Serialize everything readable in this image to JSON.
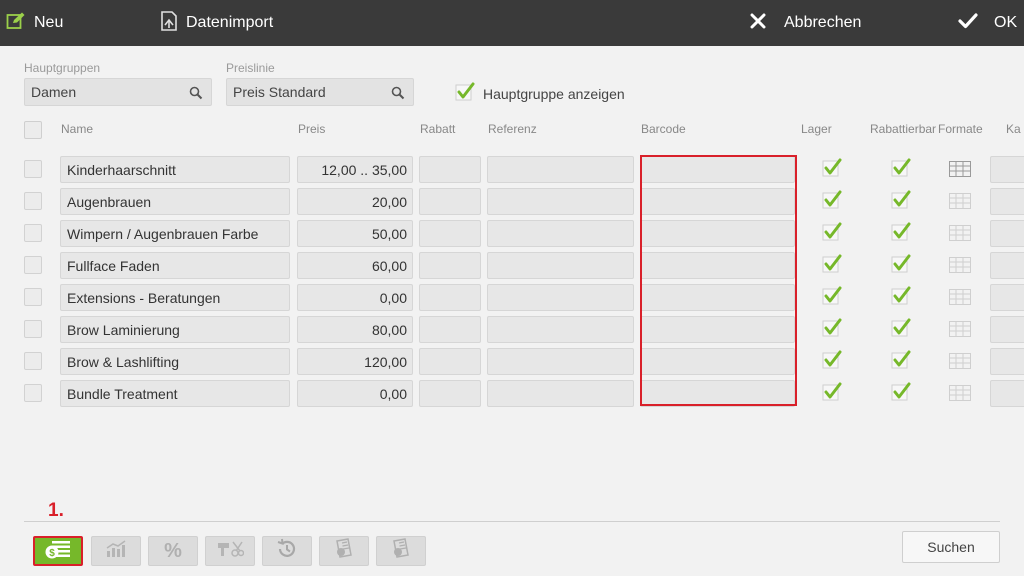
{
  "toolbar": {
    "new_label": "Neu",
    "import_label": "Datenimport",
    "cancel_label": "Abbrechen",
    "ok_label": "OK"
  },
  "filters": {
    "main_group_label": "Hauptgruppen",
    "main_group_value": "Damen",
    "price_line_label": "Preislinie",
    "price_line_value": "Preis Standard",
    "show_main_group_label": "Hauptgruppe anzeigen",
    "show_main_group_checked": true
  },
  "table": {
    "headers": {
      "name": "Name",
      "price": "Preis",
      "discount": "Rabatt",
      "reference": "Referenz",
      "barcode": "Barcode",
      "stock": "Lager",
      "discountable": "Rabattierbar",
      "formats": "Formate",
      "extra": "Ka"
    },
    "rows": [
      {
        "name": "Kinderhaarschnitt",
        "price": "12,00 .. 35,00",
        "stock": true,
        "discountable": true
      },
      {
        "name": "Augenbrauen",
        "price": "20,00",
        "stock": true,
        "discountable": true
      },
      {
        "name": "Wimpern / Augenbrauen Farbe",
        "price": "50,00",
        "stock": true,
        "discountable": true
      },
      {
        "name": "Fullface Faden",
        "price": "60,00",
        "stock": true,
        "discountable": true
      },
      {
        "name": "Extensions - Beratungen",
        "price": "0,00",
        "stock": true,
        "discountable": true
      },
      {
        "name": "Brow Laminierung",
        "price": "80,00",
        "stock": true,
        "discountable": true
      },
      {
        "name": "Brow & Lashlifting",
        "price": "120,00",
        "stock": true,
        "discountable": true
      },
      {
        "name": "Bundle Treatment",
        "price": "0,00",
        "stock": true,
        "discountable": true
      }
    ]
  },
  "bottom": {
    "step_marker": "1.",
    "tools": [
      "money-icon",
      "chart-icon",
      "percent-icon",
      "stylist-tools-icon",
      "history-icon",
      "price-list-icon",
      "price-list-alt-icon"
    ],
    "percent_symbol": "%",
    "search_label": "Suchen"
  },
  "colors": {
    "topbar": "#3a3a3a",
    "accent_green": "#76b82a",
    "highlight_red": "#d9202a"
  }
}
